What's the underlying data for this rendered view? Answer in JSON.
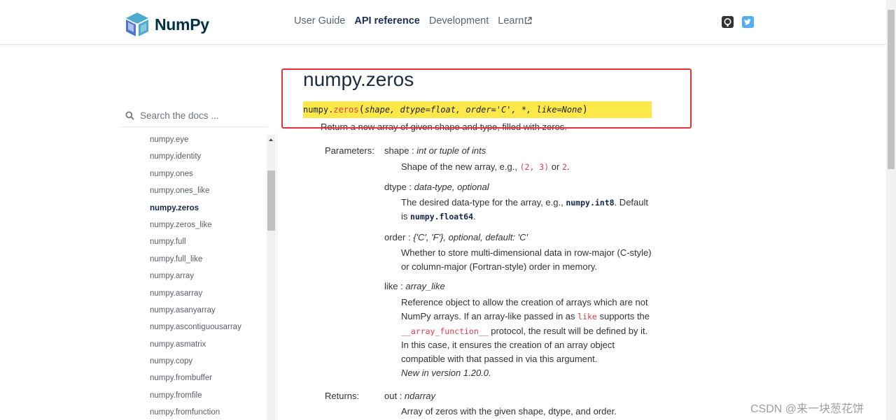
{
  "header": {
    "logo_text": "NumPy",
    "nav": [
      {
        "label": "User Guide",
        "active": false
      },
      {
        "label": "API reference",
        "active": true
      },
      {
        "label": "Development",
        "active": false
      },
      {
        "label": "Learn",
        "active": false
      }
    ],
    "social_icons": [
      "github-icon",
      "twitter-icon"
    ]
  },
  "sidebar": {
    "search_placeholder": "Search the docs ...",
    "items": [
      {
        "label": "numpy.eye",
        "active": false
      },
      {
        "label": "numpy.identity",
        "active": false
      },
      {
        "label": "numpy.ones",
        "active": false
      },
      {
        "label": "numpy.ones_like",
        "active": false
      },
      {
        "label": "numpy.zeros",
        "active": true
      },
      {
        "label": "numpy.zeros_like",
        "active": false
      },
      {
        "label": "numpy.full",
        "active": false
      },
      {
        "label": "numpy.full_like",
        "active": false
      },
      {
        "label": "numpy.array",
        "active": false
      },
      {
        "label": "numpy.asarray",
        "active": false
      },
      {
        "label": "numpy.asanyarray",
        "active": false
      },
      {
        "label": "numpy.ascontiguousarray",
        "active": false
      },
      {
        "label": "numpy.asmatrix",
        "active": false
      },
      {
        "label": "numpy.copy",
        "active": false
      },
      {
        "label": "numpy.frombuffer",
        "active": false
      },
      {
        "label": "numpy.fromfile",
        "active": false
      },
      {
        "label": "numpy.fromfunction",
        "active": false
      }
    ]
  },
  "main": {
    "title": "numpy.zeros",
    "signature": {
      "module": "numpy.",
      "name": "zeros",
      "open_paren": "(",
      "params": "shape, dtype=float, order='C', *, like=None",
      "close_paren": ")"
    },
    "summary": "Return a new array of given shape and type, filled with zeros.",
    "parameters_label": "Parameters:",
    "parameters": {
      "shape": {
        "name": "shape",
        "sep": " : ",
        "type": "int or tuple of ints",
        "desc_prefix": "Shape of the new array, e.g., ",
        "code1": "(2, 3)",
        "desc_mid": " or ",
        "code2": "2",
        "desc_suffix": "."
      },
      "dtype": {
        "name": "dtype",
        "sep": " : ",
        "type": "data-type, optional",
        "desc_prefix": "The desired data-type for the array, e.g., ",
        "code1": "numpy.int8",
        "desc_mid": ". Default is ",
        "code2": "numpy.float64",
        "desc_suffix": "."
      },
      "order": {
        "name": "order",
        "sep": " : ",
        "type": "{'C', 'F'}, optional, default: 'C'",
        "desc": "Whether to store multi-dimensional data in row-major (C-style) or column-major (Fortran-style) order in memory."
      },
      "like": {
        "name": "like",
        "sep": " : ",
        "type": "array_like",
        "desc_a": "Reference object to allow the creation of arrays which are not NumPy arrays. If an array-like passed in as ",
        "code1": "like",
        "desc_b": " supports the ",
        "code2": "__array_function__",
        "desc_c": " protocol, the result will be defined by it. In this case, it ensures the creation of an array object compatible with that passed in via this argument.",
        "version_note": "New in version 1.20.0."
      }
    },
    "returns_label": "Returns:",
    "returns": {
      "name": "out",
      "sep": " : ",
      "type": "ndarray",
      "desc": "Array of zeros with the given shape, dtype, and order."
    }
  },
  "watermark": "CSDN @来一块葱花饼",
  "colors": {
    "highlight": "#fde84a",
    "annotation_box": "#e8303a",
    "code_red": "#e23d4d",
    "brand_dark": "#013243"
  }
}
